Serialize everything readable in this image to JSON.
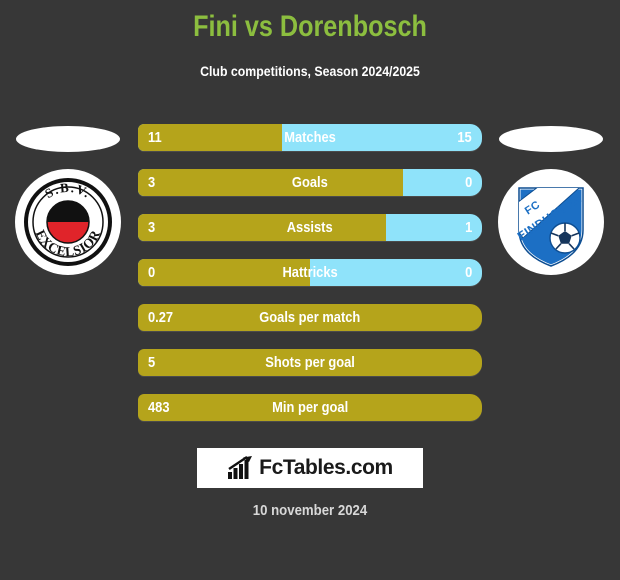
{
  "header": {
    "title": "Fini vs Dorenbosch",
    "subtitle": "Club competitions, Season 2024/2025",
    "title_color": "#8cbe3f",
    "subtitle_color": "#ffffff"
  },
  "theme": {
    "background": "#373737",
    "home_color": "#b5a41b",
    "away_color": "#8fe3fa",
    "text_color": "#ffffff"
  },
  "teams": {
    "home": {
      "crest_name": "sbv-excelsior-crest",
      "crest_line1": "S.B.V.",
      "crest_line2": "EXCELSIOR"
    },
    "away": {
      "crest_name": "fc-eindhoven-crest",
      "crest_line1": "FC",
      "crest_line2": "EINDHOVEN"
    }
  },
  "chart_data": {
    "type": "bar",
    "title": "Fini vs Dorenbosch",
    "subtitle": "Club competitions, Season 2024/2025",
    "orientation": "horizontal-diverging",
    "categories": [
      "Matches",
      "Goals",
      "Assists",
      "Hattricks",
      "Goals per match",
      "Shots per goal",
      "Min per goal"
    ],
    "series": [
      {
        "name": "Fini",
        "values": [
          "11",
          "3",
          "3",
          "0",
          "0.27",
          "5",
          "483"
        ]
      },
      {
        "name": "Dorenbosch",
        "values": [
          "15",
          "0",
          "1",
          "0",
          null,
          null,
          null
        ]
      }
    ],
    "home_share_percent": [
      42,
      77,
      72,
      50,
      100,
      100,
      100
    ]
  },
  "rows": [
    {
      "label": "Matches",
      "home": "11",
      "away": "15",
      "home_pct": 42,
      "two_sided": true
    },
    {
      "label": "Goals",
      "home": "3",
      "away": "0",
      "home_pct": 77,
      "two_sided": true
    },
    {
      "label": "Assists",
      "home": "3",
      "away": "1",
      "home_pct": 72,
      "two_sided": true
    },
    {
      "label": "Hattricks",
      "home": "0",
      "away": "0",
      "home_pct": 50,
      "two_sided": true
    },
    {
      "label": "Goals per match",
      "home": "0.27",
      "away": "",
      "home_pct": 100,
      "two_sided": false
    },
    {
      "label": "Shots per goal",
      "home": "5",
      "away": "",
      "home_pct": 100,
      "two_sided": false
    },
    {
      "label": "Min per goal",
      "home": "483",
      "away": "",
      "home_pct": 100,
      "two_sided": false
    }
  ],
  "footer": {
    "logo_text": "FcTables.com",
    "logo_icon": "bar-chart-arrow-icon",
    "date": "10 november 2024"
  }
}
